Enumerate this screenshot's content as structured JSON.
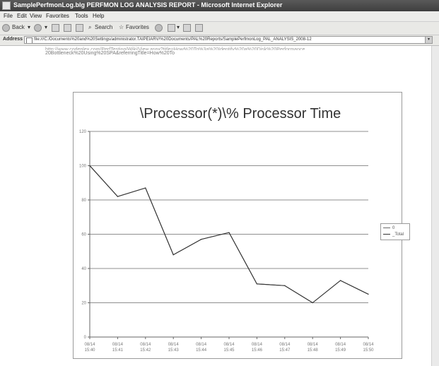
{
  "window": {
    "title": "SamplePerfmonLog.blg PERFMON LOG ANALYSIS REPORT - Microsoft Internet Explorer"
  },
  "menubar": {
    "items": [
      "File",
      "Edit",
      "View",
      "Favorites",
      "Tools",
      "Help"
    ]
  },
  "toolbar": {
    "back_label": "Back",
    "search_label": "Search",
    "favorites_label": "Favorites"
  },
  "addressbar": {
    "label": "Address",
    "value": "file:///C:/Documents%20and%20Settings/administrator.TAIPEIARV/%20Documents/PAL%20Reports/SamplePerfmonLog_PAL_ANALYSIS_2008-12"
  },
  "content": {
    "link_line1": "http://www.codeplex.com/PerfTesting/Wiki/View.aspx?title=How%20To%3a%20Identify%20a%20Disk%20Performance",
    "link_line2": "20Bottleneck%20Using%20SPA&referringTitle=How%20To"
  },
  "chart_data": {
    "type": "line",
    "title": "\\Processor(*)\\% Processor Time",
    "xlabel": "",
    "ylabel": "",
    "ylim": [
      0,
      120
    ],
    "yticks": [
      "0",
      "20",
      "40",
      "60",
      "80",
      "100",
      "120"
    ],
    "categories": [
      "08/14 15:40",
      "08/14 15:41",
      "08/14 15:42",
      "08/14 15:43",
      "08/14 15:44",
      "08/14 15:45",
      "08/14 15:46",
      "08/14 15:47",
      "08/14 15:48",
      "08/14 15:49",
      "08/14 15:50"
    ],
    "series": [
      {
        "name": "0",
        "values": [
          100,
          82,
          87,
          48,
          57,
          61,
          31,
          30,
          20,
          33,
          25
        ],
        "color": "#6a6a6a"
      },
      {
        "name": "_Total",
        "values": [
          100,
          82,
          87,
          48,
          57,
          61,
          31,
          30,
          20,
          33,
          25
        ],
        "color": "#333333"
      }
    ],
    "grid": true,
    "legend": "right"
  }
}
